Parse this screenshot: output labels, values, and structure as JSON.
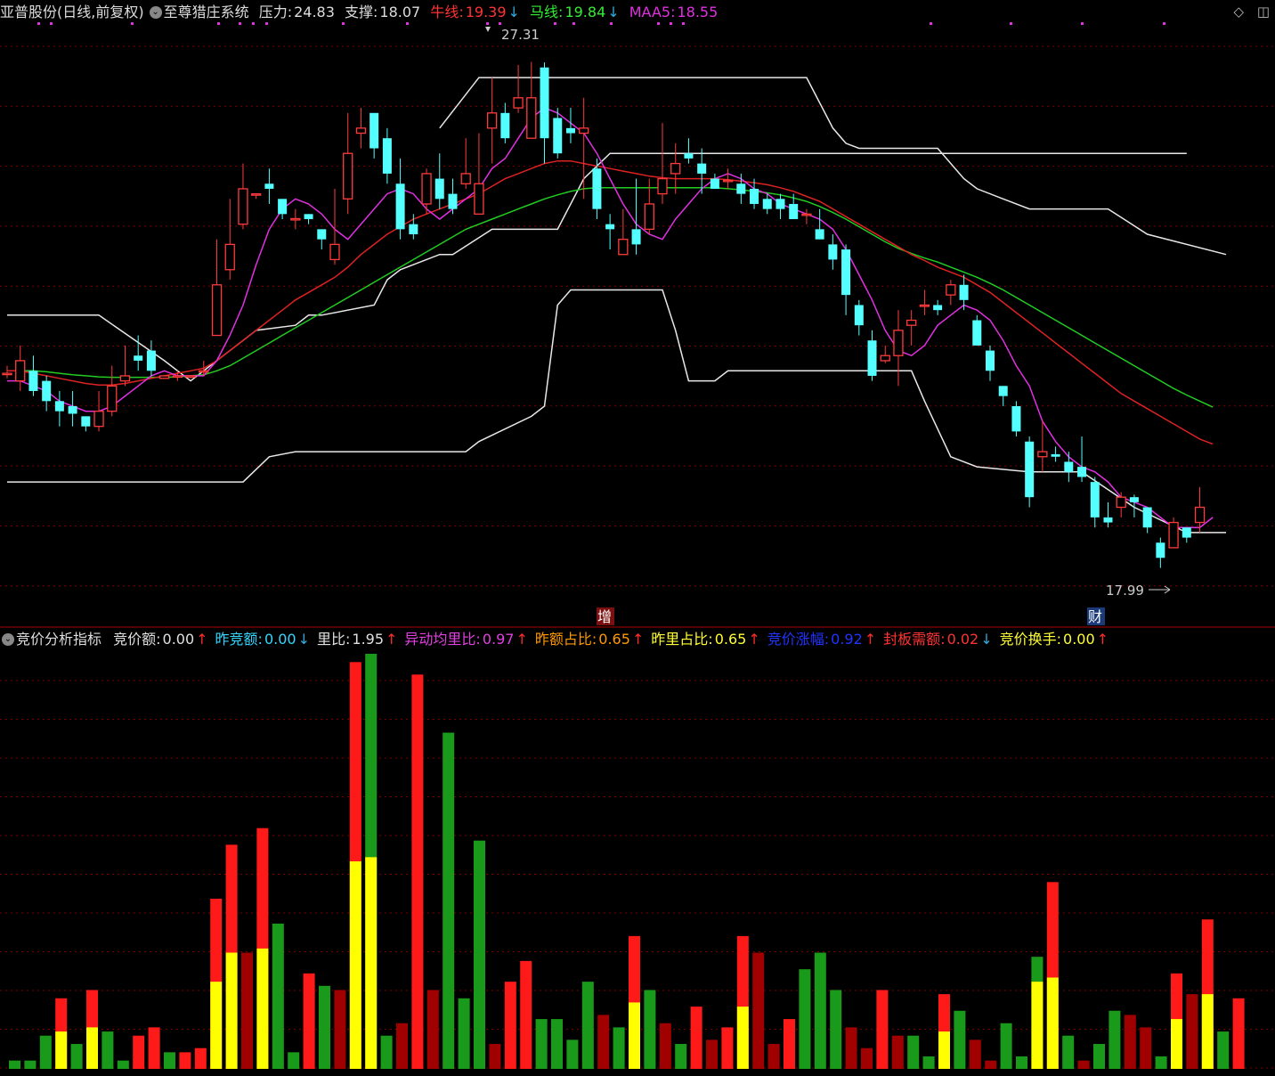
{
  "colors": {
    "up": "#ff3b3b",
    "down": "#54ffff",
    "ma_red": "#d22",
    "ma_green": "#2c2",
    "ma_magenta": "#e030e0",
    "band": "#e8e8e8",
    "grid": "#7a0000",
    "vol_red": "#ff1a1a",
    "vol_green": "#1a9a1a",
    "vol_darkred": "#a00000",
    "vol_yellow": "#ffff00"
  },
  "header": {
    "stock": "亚普股份(日线,前复权)",
    "system": "至尊猎庄系统",
    "pressure_label": "压力:",
    "pressure": "24.83",
    "support_label": "支撑:",
    "support": "18.07",
    "bull_label": "牛线:",
    "bull": "19.39",
    "horse_label": "马线:",
    "horse": "19.84",
    "maa5_label": "MAA5:",
    "maa5": "18.55"
  },
  "indicator": {
    "name": "竞价分析指标",
    "items": [
      {
        "label": "竞价额:",
        "value": "0.00",
        "dir": "up",
        "color": "#e0e0e0"
      },
      {
        "label": "昨竞额:",
        "value": "0.00",
        "dir": "down",
        "color": "#33d6ff"
      },
      {
        "label": "里比:",
        "value": "1.95",
        "dir": "up",
        "color": "#e0e0e0"
      },
      {
        "label": "异动均里比:",
        "value": "0.97",
        "dir": "up",
        "color": "#e040e0"
      },
      {
        "label": "昨额占比:",
        "value": "0.65",
        "dir": "up",
        "color": "#ff9900"
      },
      {
        "label": "昨里占比:",
        "value": "0.65",
        "dir": "up",
        "color": "#ffff33"
      },
      {
        "label": "竞价涨幅:",
        "value": "0.92",
        "dir": "up",
        "color": "#2233ff"
      },
      {
        "label": "封板需额:",
        "value": "0.02",
        "dir": "down",
        "color": "#ff3333"
      },
      {
        "label": "竞价换手:",
        "value": "0.00",
        "dir": "up",
        "color": "#ffff33"
      }
    ]
  },
  "annotations": {
    "high": "27.31",
    "low": "17.99",
    "mark1": "增",
    "mark2": "财"
  },
  "icons": {
    "diamond": "diamond-icon",
    "window": "window-icon"
  },
  "chart_data": {
    "type": "candlestick",
    "ylim": [
      16.8,
      27.9
    ],
    "candles": [
      [
        21.13,
        21.15,
        21.3,
        21.05
      ],
      [
        21.0,
        21.4,
        21.7,
        20.8
      ],
      [
        21.2,
        20.8,
        21.5,
        20.7
      ],
      [
        21.0,
        20.6,
        21.1,
        20.4
      ],
      [
        20.6,
        20.4,
        20.8,
        20.1
      ],
      [
        20.5,
        20.35,
        20.8,
        20.1
      ],
      [
        20.3,
        20.1,
        20.3,
        20.0
      ],
      [
        20.1,
        20.4,
        20.8,
        20.0
      ],
      [
        20.4,
        20.9,
        21.3,
        20.3
      ],
      [
        21.0,
        21.1,
        21.7,
        20.9
      ],
      [
        21.5,
        21.4,
        21.9,
        21.2
      ],
      [
        21.6,
        21.2,
        21.8,
        21.1
      ],
      [
        21.05,
        21.1,
        21.1,
        21.05
      ],
      [
        21.1,
        21.1,
        21.2,
        21.0
      ],
      [
        21.1,
        21.1,
        21.1,
        21.05
      ],
      [
        21.2,
        21.2,
        21.4,
        21.1
      ],
      [
        21.9,
        22.9,
        23.8,
        21.9
      ],
      [
        23.2,
        23.7,
        24.6,
        23.0
      ],
      [
        24.1,
        24.8,
        25.3,
        24.0
      ],
      [
        24.7,
        24.7,
        24.7,
        24.6
      ],
      [
        24.9,
        24.8,
        25.2,
        24.5
      ],
      [
        24.6,
        24.3,
        24.6,
        24.2
      ],
      [
        24.2,
        24.21,
        24.4,
        24.0
      ],
      [
        24.3,
        24.2,
        24.3,
        24.1
      ],
      [
        24.0,
        23.8,
        24.0,
        23.6
      ],
      [
        23.4,
        23.7,
        24.8,
        23.3
      ],
      [
        24.6,
        25.5,
        26.3,
        24.3
      ],
      [
        25.9,
        26.0,
        26.4,
        25.6
      ],
      [
        26.3,
        25.6,
        26.3,
        25.4
      ],
      [
        25.8,
        25.1,
        26.0,
        24.9
      ],
      [
        24.9,
        24.0,
        25.4,
        23.8
      ],
      [
        24.1,
        23.9,
        24.3,
        23.8
      ],
      [
        24.5,
        25.1,
        25.2,
        24.3
      ],
      [
        25.0,
        24.6,
        25.5,
        24.4
      ],
      [
        24.7,
        24.4,
        25.0,
        24.3
      ],
      [
        24.9,
        25.1,
        25.8,
        24.8
      ],
      [
        24.3,
        24.9,
        25.9,
        24.3
      ],
      [
        26.0,
        26.3,
        27.0,
        25.3
      ],
      [
        26.3,
        25.8,
        26.5,
        25.7
      ],
      [
        26.4,
        26.6,
        27.25,
        26.3
      ],
      [
        25.8,
        26.6,
        27.31,
        25.8
      ],
      [
        27.2,
        25.8,
        27.3,
        25.3
      ],
      [
        26.2,
        25.5,
        26.4,
        25.4
      ],
      [
        26.0,
        25.9,
        26.4,
        25.7
      ],
      [
        25.9,
        26.0,
        26.6,
        24.6
      ],
      [
        25.2,
        24.4,
        25.4,
        24.2
      ],
      [
        24.1,
        24.0,
        24.3,
        23.6
      ],
      [
        23.5,
        23.8,
        24.4,
        23.5
      ],
      [
        24.0,
        23.7,
        25.0,
        23.5
      ],
      [
        24.0,
        24.5,
        25.0,
        23.9
      ],
      [
        24.7,
        25.0,
        26.1,
        24.5
      ],
      [
        25.1,
        25.3,
        25.7,
        24.7
      ],
      [
        25.5,
        25.4,
        25.8,
        25.3
      ],
      [
        25.3,
        25.1,
        25.6,
        24.7
      ],
      [
        25.0,
        24.8,
        25.1,
        24.8
      ],
      [
        24.95,
        24.97,
        25.2,
        24.8
      ],
      [
        24.9,
        24.7,
        25.1,
        24.5
      ],
      [
        24.8,
        24.5,
        25.0,
        24.4
      ],
      [
        24.6,
        24.4,
        24.7,
        24.3
      ],
      [
        24.6,
        24.4,
        24.7,
        24.2
      ],
      [
        24.5,
        24.2,
        24.7,
        24.2
      ],
      [
        24.3,
        24.3,
        24.4,
        24.1
      ],
      [
        24.0,
        23.8,
        24.4,
        23.8
      ],
      [
        23.7,
        23.4,
        23.9,
        23.2
      ],
      [
        23.6,
        22.7,
        23.7,
        22.3
      ],
      [
        22.5,
        22.1,
        22.6,
        21.9
      ],
      [
        21.8,
        21.1,
        22.0,
        21.0
      ],
      [
        21.4,
        21.5,
        21.7,
        21.35
      ],
      [
        21.5,
        22.0,
        22.4,
        20.9
      ],
      [
        22.1,
        22.2,
        22.4,
        21.7
      ],
      [
        22.5,
        22.5,
        22.8,
        22.3
      ],
      [
        22.5,
        22.4,
        22.6,
        22.3
      ],
      [
        22.7,
        22.9,
        23.0,
        22.5
      ],
      [
        22.9,
        22.6,
        23.1,
        22.4
      ],
      [
        22.2,
        21.7,
        22.3,
        21.7
      ],
      [
        21.6,
        21.2,
        21.7,
        21.0
      ],
      [
        20.9,
        20.7,
        20.9,
        20.5
      ],
      [
        20.5,
        20.0,
        20.6,
        19.9
      ],
      [
        19.8,
        18.7,
        19.9,
        18.5
      ],
      [
        19.5,
        19.6,
        20.2,
        19.2
      ],
      [
        19.55,
        19.5,
        19.7,
        19.4
      ],
      [
        19.4,
        19.2,
        19.6,
        19.0
      ],
      [
        19.3,
        19.1,
        19.9,
        19.0
      ],
      [
        19.0,
        18.3,
        19.1,
        18.1
      ],
      [
        18.3,
        18.2,
        18.6,
        18.1
      ],
      [
        18.5,
        18.7,
        18.8,
        18.3
      ],
      [
        18.7,
        18.6,
        18.75,
        18.3
      ],
      [
        18.5,
        18.1,
        18.5,
        17.99
      ],
      [
        17.8,
        17.5,
        17.9,
        17.3
      ],
      [
        17.7,
        18.2,
        18.3,
        17.7
      ],
      [
        18.1,
        17.9,
        18.1,
        17.8
      ],
      [
        18.2,
        18.5,
        18.9,
        18.0
      ]
    ],
    "ma_magenta": [
      21.0,
      21.0,
      20.9,
      20.8,
      20.6,
      20.5,
      20.4,
      20.4,
      20.5,
      20.7,
      20.9,
      21.1,
      21.2,
      21.1,
      21.1,
      21.1,
      21.4,
      21.9,
      22.5,
      23.3,
      24.0,
      24.4,
      24.6,
      24.5,
      24.3,
      24.0,
      23.8,
      24.1,
      24.4,
      24.7,
      24.8,
      24.7,
      24.4,
      24.2,
      24.4,
      24.6,
      24.8,
      25.2,
      25.4,
      25.8,
      26.2,
      26.4,
      26.3,
      26.1,
      25.9,
      25.5,
      25.0,
      24.5,
      24.1,
      23.9,
      23.8,
      24.2,
      24.5,
      24.8,
      25.0,
      25.1,
      25.0,
      24.8,
      24.7,
      24.5,
      24.4,
      24.3,
      24.2,
      24.0,
      23.6,
      23.1,
      22.6,
      22.0,
      21.6,
      21.5,
      21.7,
      22.1,
      22.3,
      22.5,
      22.4,
      22.2,
      21.8,
      21.3,
      20.9,
      20.2,
      19.8,
      19.5,
      19.3,
      19.2,
      19.0,
      18.7,
      18.6,
      18.5,
      18.3,
      18.1,
      18.1,
      18.1,
      18.3
    ],
    "ma_red": [
      21.2,
      21.2,
      21.15,
      21.1,
      21.05,
      21.0,
      20.95,
      20.92,
      20.92,
      20.95,
      21.0,
      21.05,
      21.1,
      21.15,
      21.2,
      21.25,
      21.4,
      21.6,
      21.8,
      22.0,
      22.2,
      22.4,
      22.6,
      22.75,
      22.9,
      23.05,
      23.25,
      23.5,
      23.7,
      23.9,
      24.05,
      24.2,
      24.3,
      24.4,
      24.5,
      24.6,
      24.7,
      24.85,
      25.0,
      25.1,
      25.2,
      25.3,
      25.35,
      25.35,
      25.3,
      25.25,
      25.2,
      25.15,
      25.1,
      25.05,
      25.02,
      25.0,
      25.0,
      25.0,
      25.0,
      24.98,
      24.95,
      24.92,
      24.88,
      24.82,
      24.75,
      24.65,
      24.55,
      24.4,
      24.25,
      24.1,
      23.95,
      23.8,
      23.65,
      23.5,
      23.38,
      23.25,
      23.15,
      23.05,
      22.9,
      22.75,
      22.55,
      22.35,
      22.15,
      21.95,
      21.75,
      21.55,
      21.35,
      21.15,
      20.95,
      20.75,
      20.6,
      20.45,
      20.3,
      20.15,
      20.0,
      19.85,
      19.75
    ],
    "ma_green": [
      21.2,
      21.2,
      21.2,
      21.18,
      21.15,
      21.12,
      21.1,
      21.08,
      21.07,
      21.07,
      21.07,
      21.07,
      21.07,
      21.08,
      21.1,
      21.12,
      21.2,
      21.3,
      21.45,
      21.6,
      21.75,
      21.9,
      22.05,
      22.2,
      22.35,
      22.5,
      22.65,
      22.8,
      22.95,
      23.1,
      23.25,
      23.4,
      23.55,
      23.7,
      23.85,
      24.0,
      24.1,
      24.2,
      24.3,
      24.4,
      24.5,
      24.6,
      24.68,
      24.75,
      24.8,
      24.82,
      24.82,
      24.82,
      24.82,
      24.82,
      24.82,
      24.82,
      24.82,
      24.82,
      24.82,
      24.8,
      24.78,
      24.75,
      24.72,
      24.68,
      24.62,
      24.55,
      24.45,
      24.33,
      24.2,
      24.05,
      23.9,
      23.75,
      23.62,
      23.52,
      23.43,
      23.35,
      23.25,
      23.15,
      23.05,
      22.93,
      22.8,
      22.65,
      22.5,
      22.35,
      22.2,
      22.05,
      21.9,
      21.75,
      21.6,
      21.45,
      21.3,
      21.15,
      21.0,
      20.85,
      20.72,
      20.6,
      20.48
    ],
    "band_upper_points": [
      [
        0,
        22.3
      ],
      [
        7,
        22.3
      ],
      [
        12,
        21.4
      ],
      [
        14,
        21.0
      ],
      [
        19,
        22.0
      ],
      [
        22,
        22.1
      ],
      [
        23,
        22.3
      ],
      [
        24,
        22.3
      ],
      [
        28,
        22.5
      ],
      [
        29,
        23.0
      ],
      [
        30,
        23.2
      ],
      [
        33,
        23.5
      ],
      [
        34,
        23.5
      ],
      [
        37,
        24.0
      ],
      [
        42,
        24.0
      ],
      [
        44,
        25.0
      ],
      [
        46,
        25.5
      ],
      [
        60,
        25.5
      ],
      [
        75,
        25.5
      ],
      [
        80,
        25.5
      ],
      [
        90,
        25.5
      ]
    ],
    "band_top_points": [
      [
        33,
        26.0
      ],
      [
        36,
        27.0
      ],
      [
        61,
        27.0
      ],
      [
        63,
        26.0
      ],
      [
        64,
        25.7
      ],
      [
        65,
        25.6
      ],
      [
        71,
        25.6
      ],
      [
        73,
        25.0
      ],
      [
        74,
        24.8
      ],
      [
        76,
        24.6
      ],
      [
        78,
        24.4
      ],
      [
        84,
        24.4
      ],
      [
        87,
        23.9
      ],
      [
        93,
        23.5
      ]
    ],
    "band_lower_points": [
      [
        0,
        19.0
      ],
      [
        18,
        19.0
      ],
      [
        20,
        19.5
      ],
      [
        22,
        19.6
      ],
      [
        35,
        19.6
      ],
      [
        36,
        19.8
      ],
      [
        40,
        20.3
      ],
      [
        41,
        20.5
      ],
      [
        42,
        22.5
      ],
      [
        43,
        22.8
      ],
      [
        49,
        22.8
      ],
      [
        50,
        22.8
      ],
      [
        51,
        22.0
      ],
      [
        52,
        21.0
      ],
      [
        54,
        21.0
      ],
      [
        55,
        21.2
      ],
      [
        61,
        21.2
      ],
      [
        66,
        21.2
      ],
      [
        69,
        21.2
      ],
      [
        70,
        20.6
      ],
      [
        72,
        19.5
      ],
      [
        74,
        19.3
      ],
      [
        78,
        19.2
      ],
      [
        82,
        19.2
      ],
      [
        86,
        18.5
      ],
      [
        90,
        18.0
      ],
      [
        93,
        18.0
      ]
    ],
    "volume": {
      "ylim": [
        0,
        100
      ],
      "bars": [
        [
          2,
          "g",
          0
        ],
        [
          2,
          "g",
          0
        ],
        [
          8,
          "g",
          0
        ],
        [
          17,
          "r",
          9
        ],
        [
          6,
          "g",
          0
        ],
        [
          19,
          "r",
          10
        ],
        [
          9,
          "g",
          0
        ],
        [
          2,
          "g",
          0
        ],
        [
          8,
          "r",
          0
        ],
        [
          10,
          "r",
          0
        ],
        [
          4,
          "g",
          0
        ],
        [
          4,
          "r",
          0
        ],
        [
          5,
          "r",
          0
        ],
        [
          41,
          "r",
          21
        ],
        [
          54,
          "r",
          28
        ],
        [
          28,
          "d",
          0
        ],
        [
          58,
          "r",
          29
        ],
        [
          35,
          "g",
          0
        ],
        [
          4,
          "g",
          0
        ],
        [
          23,
          "r",
          0
        ],
        [
          20,
          "g",
          0
        ],
        [
          19,
          "d",
          0
        ],
        [
          98,
          "r",
          50
        ],
        [
          100,
          "g",
          51
        ],
        [
          8,
          "g",
          0
        ],
        [
          11,
          "d",
          0
        ],
        [
          95,
          "r",
          0
        ],
        [
          19,
          "d",
          0
        ],
        [
          81,
          "g",
          0
        ],
        [
          17,
          "g",
          0
        ],
        [
          55,
          "g",
          0
        ],
        [
          6,
          "d",
          0
        ],
        [
          21,
          "r",
          0
        ],
        [
          26,
          "r",
          0
        ],
        [
          12,
          "g",
          0
        ],
        [
          12,
          "g",
          0
        ],
        [
          7,
          "g",
          0
        ],
        [
          21,
          "g",
          0
        ],
        [
          13,
          "d",
          0
        ],
        [
          10,
          "g",
          0
        ],
        [
          32,
          "r",
          16
        ],
        [
          19,
          "g",
          0
        ],
        [
          11,
          "d",
          0
        ],
        [
          6,
          "g",
          0
        ],
        [
          15,
          "r",
          0
        ],
        [
          7,
          "d",
          0
        ],
        [
          10,
          "r",
          0
        ],
        [
          32,
          "r",
          15
        ],
        [
          28,
          "d",
          0
        ],
        [
          6,
          "d",
          0
        ],
        [
          12,
          "r",
          0
        ],
        [
          24,
          "g",
          0
        ],
        [
          28,
          "g",
          0
        ],
        [
          19,
          "g",
          0
        ],
        [
          10,
          "d",
          0
        ],
        [
          5,
          "d",
          0
        ],
        [
          19,
          "r",
          0
        ],
        [
          8,
          "d",
          0
        ],
        [
          8,
          "g",
          0
        ],
        [
          3,
          "g",
          0
        ],
        [
          18,
          "r",
          9
        ],
        [
          14,
          "g",
          0
        ],
        [
          7,
          "d",
          0
        ],
        [
          2,
          "d",
          0
        ],
        [
          11,
          "g",
          0
        ],
        [
          3,
          "g",
          0
        ],
        [
          27,
          "g",
          21
        ],
        [
          45,
          "r",
          22
        ],
        [
          8,
          "g",
          0
        ],
        [
          2,
          "d",
          0
        ],
        [
          6,
          "g",
          0
        ],
        [
          14,
          "g",
          0
        ],
        [
          13,
          "d",
          0
        ],
        [
          10,
          "d",
          0
        ],
        [
          3,
          "g",
          0
        ],
        [
          23,
          "r",
          12
        ],
        [
          18,
          "d",
          0
        ],
        [
          36,
          "r",
          18
        ],
        [
          9,
          "g",
          0
        ],
        [
          17,
          "r",
          0
        ]
      ]
    }
  }
}
